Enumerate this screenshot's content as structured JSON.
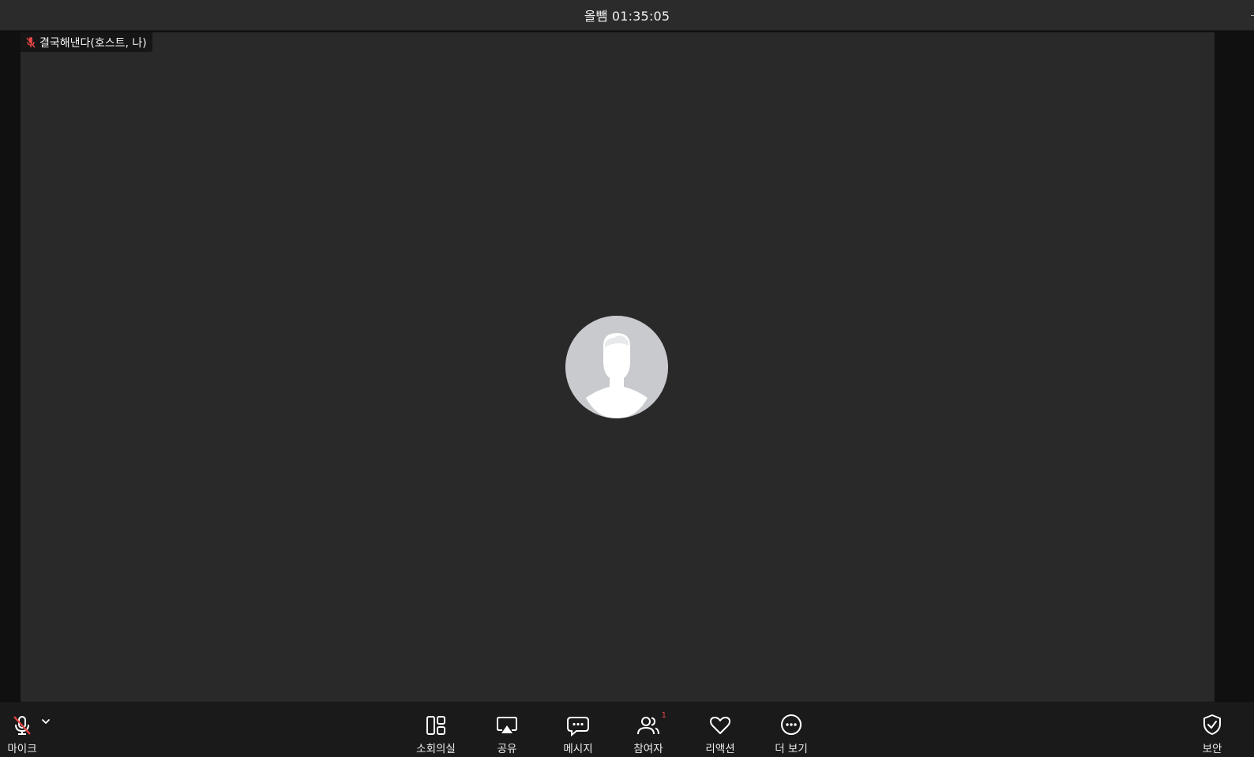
{
  "window": {
    "title": "올뺌 01:35:05"
  },
  "participant": {
    "name_label": "결국해낸다(호스트, 나)",
    "muted": true
  },
  "toolbar": {
    "mic_label": "마이크",
    "breakout_label": "소회의실",
    "share_label": "공유",
    "chat_label": "메시지",
    "participants_label": "참여자",
    "participants_count": "1",
    "reactions_label": "리액션",
    "more_label": "더 보기",
    "security_label": "보안"
  },
  "colors": {
    "mute_red": "#e64545",
    "video_bg": "#292929",
    "toolbar_bg": "#1a1a1a",
    "avatar_bg": "#c8cacd"
  }
}
